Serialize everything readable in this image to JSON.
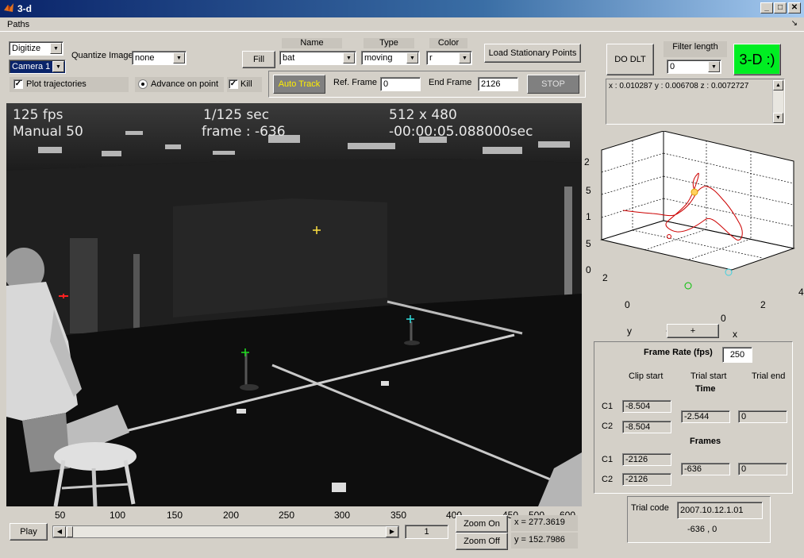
{
  "window": {
    "title": "3-d",
    "min": "_",
    "max": "□",
    "close": "✕"
  },
  "menu": {
    "paths": "Paths",
    "corner": "↘"
  },
  "controls": {
    "mode": "Digitize",
    "camera": "Camera 1",
    "quantize_label": "Quantize Image",
    "quantize_value": "none",
    "fill": "Fill",
    "name_header": "Name",
    "name_value": "bat",
    "type_header": "Type",
    "type_value": "moving",
    "color_header": "Color",
    "color_value": "r",
    "load_stationary": "Load Stationary Points",
    "do_dlt": "DO DLT",
    "filter_header": "Filter length",
    "filter_value": "0",
    "three_d_button": "3-D :)",
    "plot_trajectories": "Plot trajectories",
    "advance_on_point": "Advance on point",
    "kill": "Kill",
    "auto_track": "Auto Track",
    "ref_frame_label": "Ref. Frame",
    "ref_frame_value": "0",
    "end_frame_label": "End Frame",
    "end_frame_value": "2126",
    "stop": "STOP",
    "xyz_readout": "x : 0.010287 y : 0.006708 z : 0.0072727"
  },
  "video": {
    "fps_overlay": "125 fps",
    "shutter_overlay": "1/125 sec",
    "resolution_overlay": "512 x 480",
    "manual_overlay": "Manual 50",
    "frame_overlay": "frame : -636",
    "time_overlay": "-00:00:05.088000sec",
    "xticks": [
      "50",
      "100",
      "150",
      "200",
      "250",
      "300",
      "350",
      "400",
      "450",
      "500",
      "600"
    ]
  },
  "plot3d": {
    "zticks": [
      "2",
      "5",
      "1",
      "5",
      "0"
    ],
    "yticks": [
      "2",
      "0",
      "-"
    ],
    "xticks": [
      "0",
      "2",
      "4"
    ],
    "ylabel": "y",
    "xlabel": "x",
    "plus_button": "+"
  },
  "bottom": {
    "play": "Play",
    "frame_value": "1",
    "zoom_on": "Zoom On",
    "zoom_off": "Zoom Off",
    "x_readout": "x = 277.3619",
    "y_readout": "y = 152.7986"
  },
  "timing": {
    "frame_rate_label": "Frame Rate (fps)",
    "frame_rate_value": "250",
    "clip_start": "Clip start",
    "trial_start": "Trial start",
    "trial_end": "Trial end",
    "time_header": "Time",
    "frames_header": "Frames",
    "c1": "C1",
    "c2": "C2",
    "time_c1_clip": "-8.504",
    "time_c2_clip": "-8.504",
    "time_trial_start": "-2.544",
    "time_trial_end": "0",
    "frames_c1_clip": "-2126",
    "frames_c2_clip": "-2126",
    "frames_trial_start": "-636",
    "frames_trial_end": "0"
  },
  "trial": {
    "label": "Trial code",
    "code": "2007.10.12.1.01",
    "result": "-636 , 0"
  },
  "colors": {
    "go_button": "#00ee22",
    "trajectory": "#cc0000"
  }
}
